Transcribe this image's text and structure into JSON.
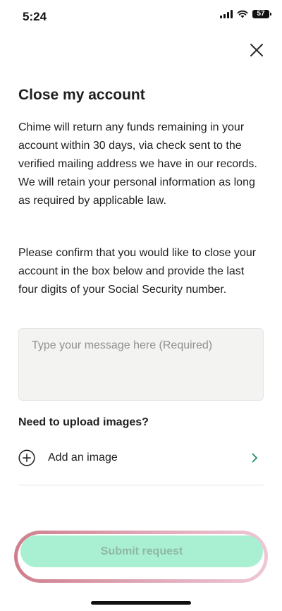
{
  "status_bar": {
    "time": "5:24",
    "battery": "57"
  },
  "page": {
    "title": "Close my account",
    "paragraph1": "Chime will return any funds remaining in your account within 30 days, via check sent to the verified mailing address we have in our records. We will retain your personal information as long as required by applicable law.",
    "paragraph2": "Please confirm that you would like to close your account in the box below and provide the last four digits of your Social Security number."
  },
  "message": {
    "placeholder": "Type your message here (Required)",
    "value": ""
  },
  "upload": {
    "heading": "Need to upload images?",
    "add_image_label": "Add an image"
  },
  "submit": {
    "label": "Submit request"
  },
  "colors": {
    "submit_bg": "#a9efd1",
    "submit_text": "#8fb8a6",
    "chevron": "#1e8a6d",
    "outline_start": "#cf7e8c",
    "outline_end": "#efc7d6"
  },
  "icons": {
    "close": "close-icon",
    "add": "plus-circle-icon",
    "chevron": "chevron-right-icon"
  }
}
